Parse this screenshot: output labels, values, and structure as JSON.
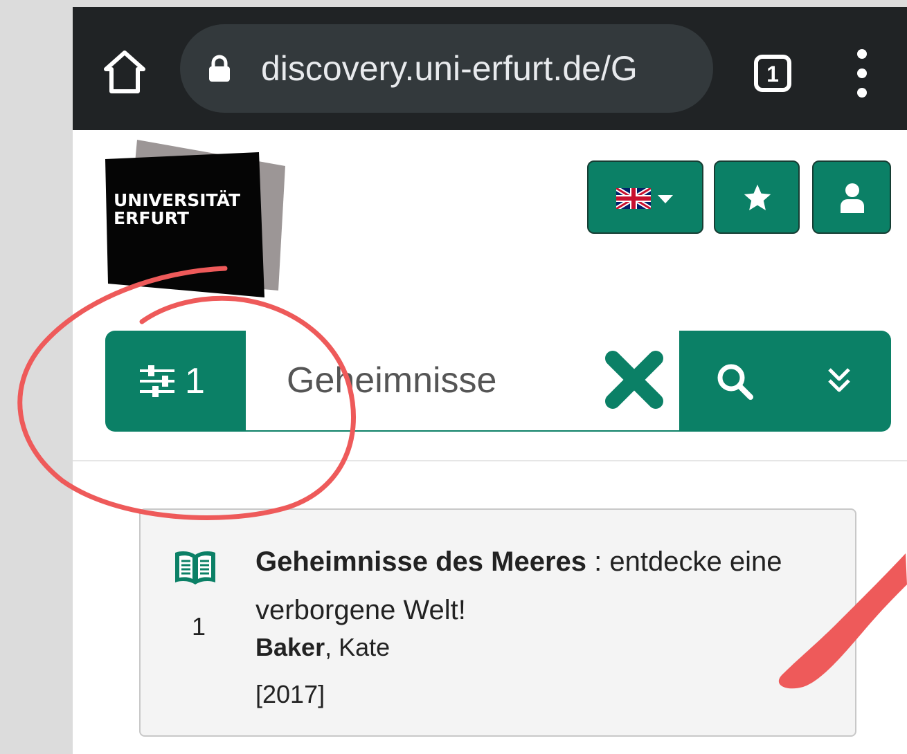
{
  "browser": {
    "url": "discovery.uni-erfurt.de/G",
    "tab_count": "1"
  },
  "header": {
    "logo_text_line1": "UNIVERSITÄT",
    "logo_text_line2": "ERFURT",
    "language_icon": "uk-flag-icon",
    "favorites_icon": "star-icon",
    "account_icon": "user-icon"
  },
  "search": {
    "filter_count": "1",
    "query": "Geheimnisse",
    "clear_icon": "close-icon",
    "submit_icon": "search-icon",
    "expand_icon": "chevron-double-down-icon"
  },
  "results": [
    {
      "number": "1",
      "type_icon": "book-icon",
      "title_main": "Geheimnisse des Meeres",
      "title_sub": " : entdecke eine verborgene Welt!",
      "author_last": "Baker",
      "author_first": ", Kate",
      "date": "[2017]"
    }
  ],
  "colors": {
    "accent": "#0b8066",
    "browser_bar": "#202325",
    "annotation": "#ee5a5a"
  }
}
